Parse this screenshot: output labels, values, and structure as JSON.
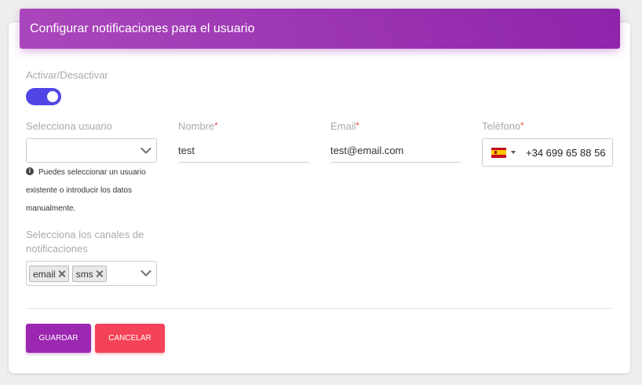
{
  "header": {
    "title": "Configurar notificaciones para el usuario"
  },
  "toggle": {
    "label": "Activar/Desactivar",
    "on": true
  },
  "user_select": {
    "label": "Selecciona usuario",
    "value": "",
    "hint": "Puedes seleccionar un usuario existente o introducir los datos manualmente."
  },
  "fields": {
    "name": {
      "label": "Nombre",
      "value": "test"
    },
    "email": {
      "label": "Email",
      "value": "test@email.com"
    },
    "phone": {
      "label": "Teléfono",
      "value": "+34 699 65 88 56",
      "country_flag": "spain-flag-icon"
    }
  },
  "required_mark": "*",
  "channels": {
    "label_line1": "Selecciona los canales de",
    "label_line2": "notificaciones",
    "selected": [
      "email",
      "sms"
    ]
  },
  "buttons": {
    "save": "Guardar",
    "cancel": "Cancelar"
  },
  "colors": {
    "header_gradient": [
      "#ab47bc",
      "#8e24aa"
    ],
    "toggle_on": "#4f46e5",
    "save_button": "#9c27b0",
    "cancel_button": "#f44358",
    "required": "#e53935"
  }
}
